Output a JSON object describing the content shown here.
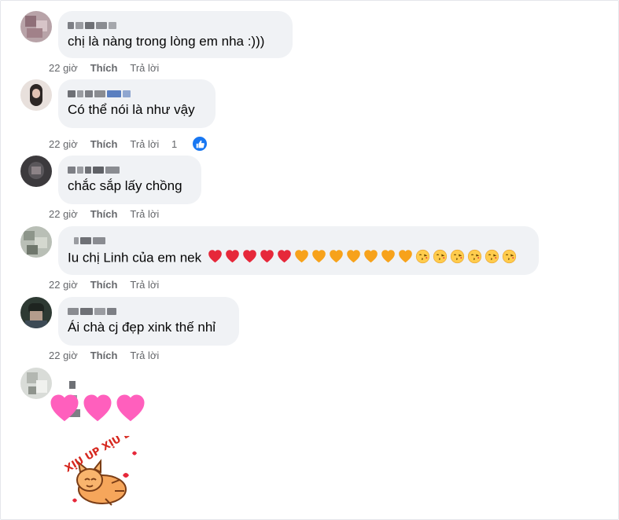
{
  "comments": [
    {
      "text": "chị là nàng trong lòng em nha :)))",
      "time": "22 giờ",
      "like": "Thích",
      "reply": "Trả lời"
    },
    {
      "text": "Có thể nói là như vậy",
      "time": "22 giờ",
      "like": "Thích",
      "reply": "Trả lời",
      "reaction_count": "1"
    },
    {
      "text": "chắc sắp lấy chồng",
      "time": "22 giờ",
      "like": "Thích",
      "reply": "Trả lời"
    },
    {
      "text": "Iu chị Linh của em nek",
      "time": "22 giờ",
      "like": "Thích",
      "reply": "Trả lời",
      "emojis": [
        "red-heart",
        "red-heart",
        "red-heart",
        "red-heart",
        "red-heart",
        "orange-heart",
        "orange-heart",
        "orange-heart",
        "orange-heart",
        "orange-heart",
        "orange-heart",
        "orange-heart",
        "kissing-face",
        "kissing-face",
        "kissing-face",
        "kissing-face",
        "kissing-face",
        "kissing-face"
      ]
    },
    {
      "text": "Ái chà cj đẹp xink thế nhỉ",
      "time": "22 giờ",
      "like": "Thích",
      "reply": "Trả lời"
    },
    {
      "emojis": [
        "pink-heart",
        "pink-heart",
        "pink-heart"
      ],
      "sticker": "Xịu up xịu down cat sticker",
      "sticker_text": "XỊU UP XỊU DOWN!"
    }
  ],
  "colors": {
    "bubble": "#f0f2f5",
    "meta": "#65676b",
    "like_blue": "#1877f2",
    "red_heart": "#e6283a",
    "orange_heart": "#f7a21b",
    "pink_heart": "#ff5fbd"
  }
}
